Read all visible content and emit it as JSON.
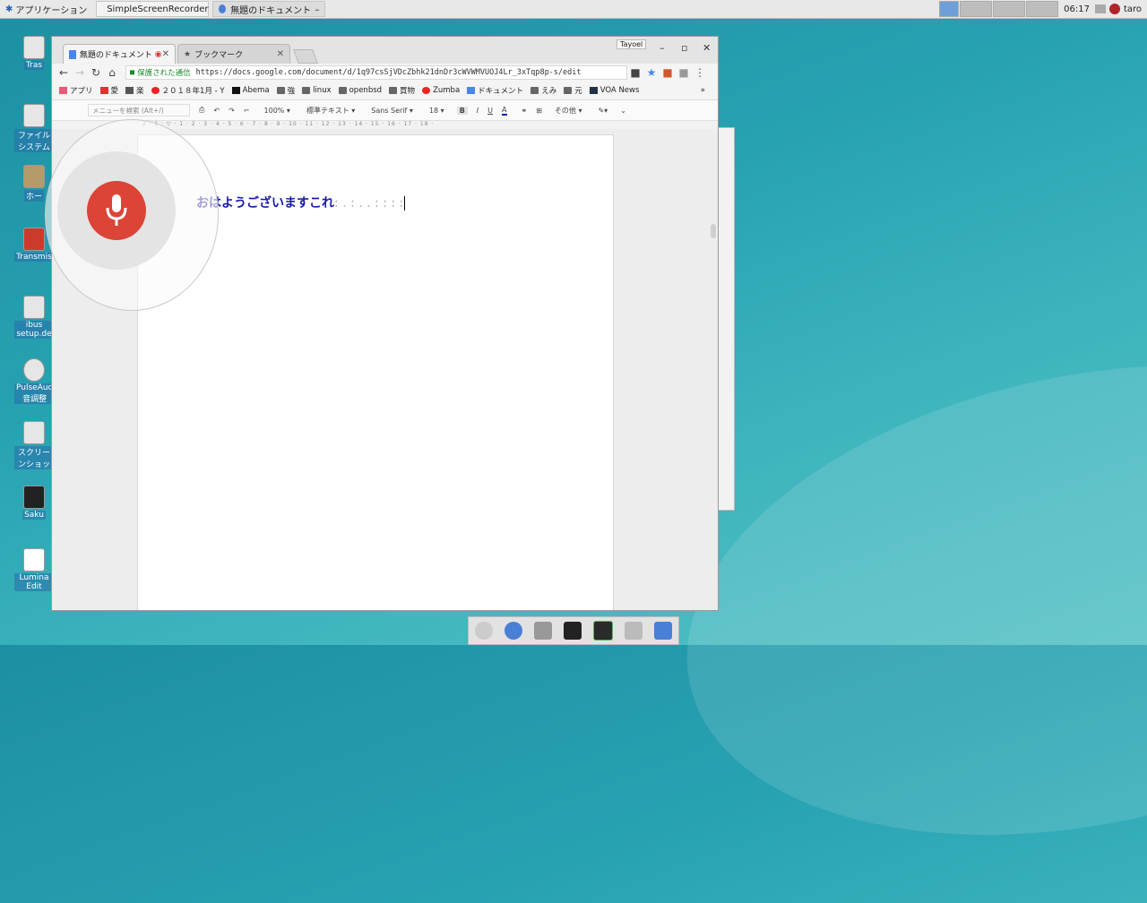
{
  "top_panel": {
    "apps_menu": "アプリケーション",
    "tasks": [
      {
        "label": "SimpleScreenRecorder"
      },
      {
        "label": "無題のドキュメント － G…"
      }
    ],
    "clock": "06:17",
    "user": "taro"
  },
  "desktop_icons": [
    {
      "label": "Tras"
    },
    {
      "label": "ファイルシステム"
    },
    {
      "label": "ホー"
    },
    {
      "label": "Transmis"
    },
    {
      "label": "ibus setup.de"
    },
    {
      "label": "PulseAud 音調整"
    },
    {
      "label": "スクリーンショッ"
    },
    {
      "label": "Saku"
    },
    {
      "label": "Lumina Edit"
    }
  ],
  "browser": {
    "tabs": [
      {
        "title": "無題のドキュメント"
      },
      {
        "title": "ブックマーク"
      }
    ],
    "profile": "Tayoel",
    "secure_label": "保護された通信",
    "url": "https://docs.google.com/document/d/1q97csSjVDcZbhk21dnDr3cWVWMVUOJ4Lr_3xTqp8p-s/edit",
    "bookmarks": [
      {
        "label": "アプリ",
        "icon": "apps-icon"
      },
      {
        "label": "愛",
        "icon": "gmail-icon"
      },
      {
        "label": "楽",
        "icon": "calendar-icon"
      },
      {
        "label": "２０１８年1月 - Y",
        "icon": "youtube-icon"
      },
      {
        "label": "Abema",
        "icon": "tv-icon"
      },
      {
        "label": "強",
        "icon": "folder-icon"
      },
      {
        "label": "linux",
        "icon": "folder-icon"
      },
      {
        "label": "openbsd",
        "icon": "folder-icon"
      },
      {
        "label": "買物",
        "icon": "folder-icon"
      },
      {
        "label": "Zumba",
        "icon": "youtube-icon"
      },
      {
        "label": "ドキュメント",
        "icon": "docs-icon"
      },
      {
        "label": "えみ",
        "icon": "folder-icon"
      },
      {
        "label": "元",
        "icon": "folder-icon"
      },
      {
        "label": "VOA News",
        "icon": "voa-icon"
      }
    ]
  },
  "docs_toolbar": {
    "menu_search": "メニューを検索 (Alt+/)",
    "zoom": "100%",
    "style": "標準テキスト",
    "font": "Sans Serif",
    "size": "18",
    "bold": "B",
    "italic": "I",
    "underline": "U",
    "text_color": "A",
    "more": "その他"
  },
  "ruler": "· 2 · 1 · ▽ · 1 · 2 · 3 · 4 · 5 · 6 · 7 · 8 · 9 · 10 · 11 · 12 · 13 · 14 · 15 · 16 · 17 · 18 ·",
  "document": {
    "text_main": "おはようございますこれ",
    "text_faint": ": . : . . : : : :"
  },
  "colors": {
    "mic": "#db4437",
    "doc_text": "#1a1aa8",
    "secure": "#1a8a2a"
  }
}
